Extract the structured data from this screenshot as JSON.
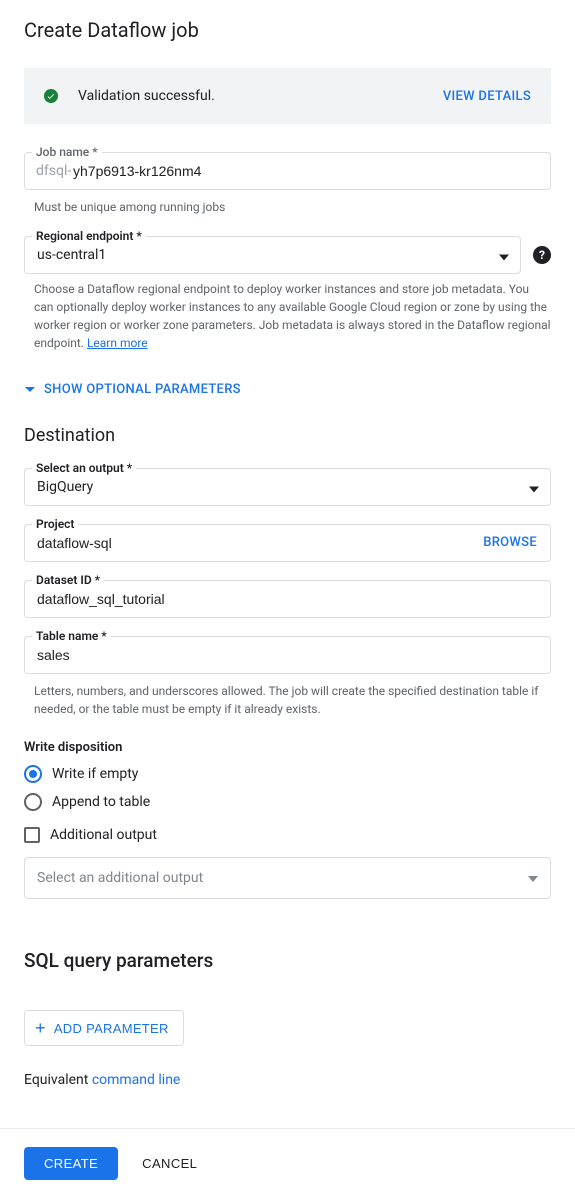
{
  "page": {
    "title": "Create Dataflow job"
  },
  "validation": {
    "message": "Validation successful.",
    "action": "VIEW DETAILS"
  },
  "jobname": {
    "label": "Job name *",
    "prefix": "dfsql-",
    "value": "yh7p6913-kr126nm4",
    "helper": "Must be unique among running jobs"
  },
  "endpoint": {
    "label": "Regional endpoint *",
    "value": "us-central1",
    "helper": "Choose a Dataflow regional endpoint to deploy worker instances and store job metadata. You can optionally deploy worker instances to any available Google Cloud region or zone by using the worker region or worker zone parameters. Job metadata is always stored in the Dataflow regional endpoint. ",
    "learn_more": "Learn more"
  },
  "expander": {
    "label": "SHOW OPTIONAL PARAMETERS"
  },
  "destination": {
    "title": "Destination",
    "output": {
      "label": "Select an output *",
      "value": "BigQuery"
    },
    "project": {
      "label": "Project",
      "value": "dataflow-sql",
      "browse": "BROWSE"
    },
    "dataset": {
      "label": "Dataset ID *",
      "value": "dataflow_sql_tutorial"
    },
    "table": {
      "label": "Table name *",
      "value": "sales",
      "helper": "Letters, numbers, and underscores allowed. The job will create the specified destination table if needed, or the table must be empty if it already exists."
    }
  },
  "write_disposition": {
    "label": "Write disposition",
    "option1": "Write if empty",
    "option2": "Append to table"
  },
  "additional_output": {
    "checkbox_label": "Additional output",
    "placeholder": "Select an additional output"
  },
  "sql": {
    "title": "SQL query parameters",
    "add_button": "ADD PARAMETER"
  },
  "equivalent": {
    "prefix": "Equivalent ",
    "link": "command line"
  },
  "footer": {
    "create": "CREATE",
    "cancel": "CANCEL"
  }
}
